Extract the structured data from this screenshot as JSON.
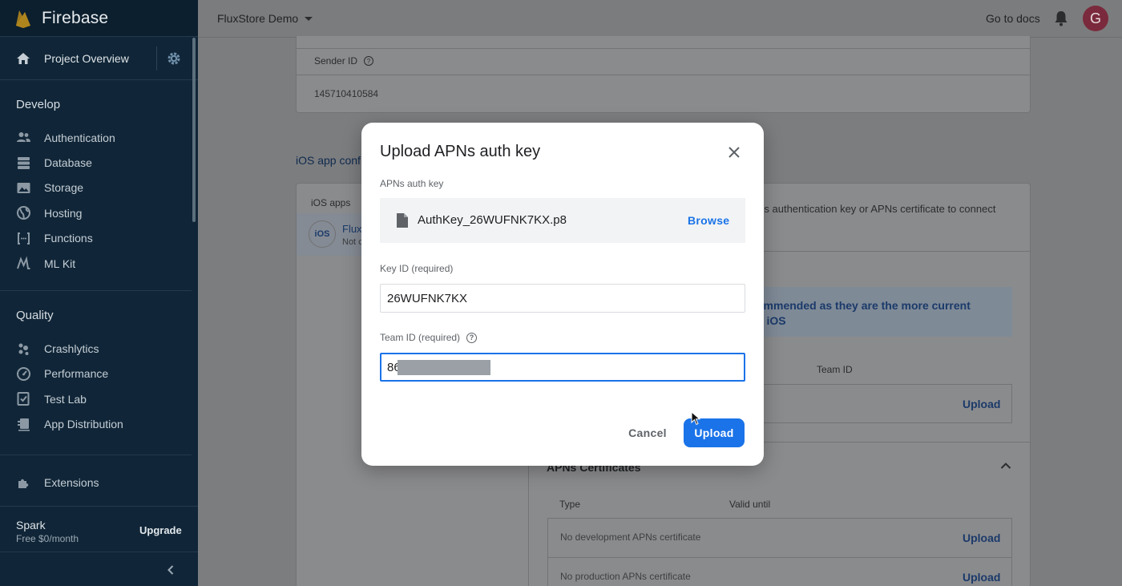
{
  "brand": {
    "name": "Firebase"
  },
  "sidebar": {
    "overview_label": "Project Overview",
    "sections": [
      {
        "title": "Develop",
        "items": [
          {
            "label": "Authentication",
            "icon": "people-icon"
          },
          {
            "label": "Database",
            "icon": "database-icon"
          },
          {
            "label": "Storage",
            "icon": "image-icon"
          },
          {
            "label": "Hosting",
            "icon": "globe-icon"
          },
          {
            "label": "Functions",
            "icon": "functions-icon"
          },
          {
            "label": "ML Kit",
            "icon": "ml-kit-icon"
          }
        ]
      },
      {
        "title": "Quality",
        "items": [
          {
            "label": "Crashlytics",
            "icon": "crashlytics-icon"
          },
          {
            "label": "Performance",
            "icon": "speedometer-icon"
          },
          {
            "label": "Test Lab",
            "icon": "checklist-icon"
          },
          {
            "label": "App Distribution",
            "icon": "distribution-icon"
          }
        ]
      }
    ],
    "extensions_label": "Extensions",
    "plan": {
      "name": "Spark",
      "price": "Free $0/month",
      "upgrade_label": "Upgrade"
    }
  },
  "topbar": {
    "project_name": "FluxStore Demo",
    "docs_label": "Go to docs",
    "avatar_initial": "G"
  },
  "background": {
    "sender_id_label": "Sender ID",
    "sender_id_value": "145710410584",
    "ios_config_title": "iOS app confi",
    "ios_apps_label": "iOS apps",
    "app_badge": "iOS",
    "app_name": "Flux",
    "app_status": "Not c",
    "apns_intro": "Ns authentication key or APNs certificate to connect",
    "info_line1": "ommended as they are the more current",
    "info_line2": "o iOS",
    "team_id_col": "Team ID",
    "upload_label": "Upload",
    "apns_certificates_title": "APNs Certificates",
    "cert_cols": {
      "type": "Type",
      "valid_until": "Valid until"
    },
    "cert_rows": [
      {
        "label": "No development APNs certificate",
        "action": "Upload"
      },
      {
        "label": "No production APNs certificate",
        "action": "Upload"
      }
    ]
  },
  "modal": {
    "title": "Upload APNs auth key",
    "auth_key_label": "APNs auth key",
    "file_name": "AuthKey_26WUFNK7KX.p8",
    "browse_label": "Browse",
    "key_id_label": "Key ID (required)",
    "key_id_value": "26WUFNK7KX",
    "team_id_label": "Team ID (required)",
    "team_id_value": "86",
    "cancel_label": "Cancel",
    "upload_label": "Upload"
  }
}
